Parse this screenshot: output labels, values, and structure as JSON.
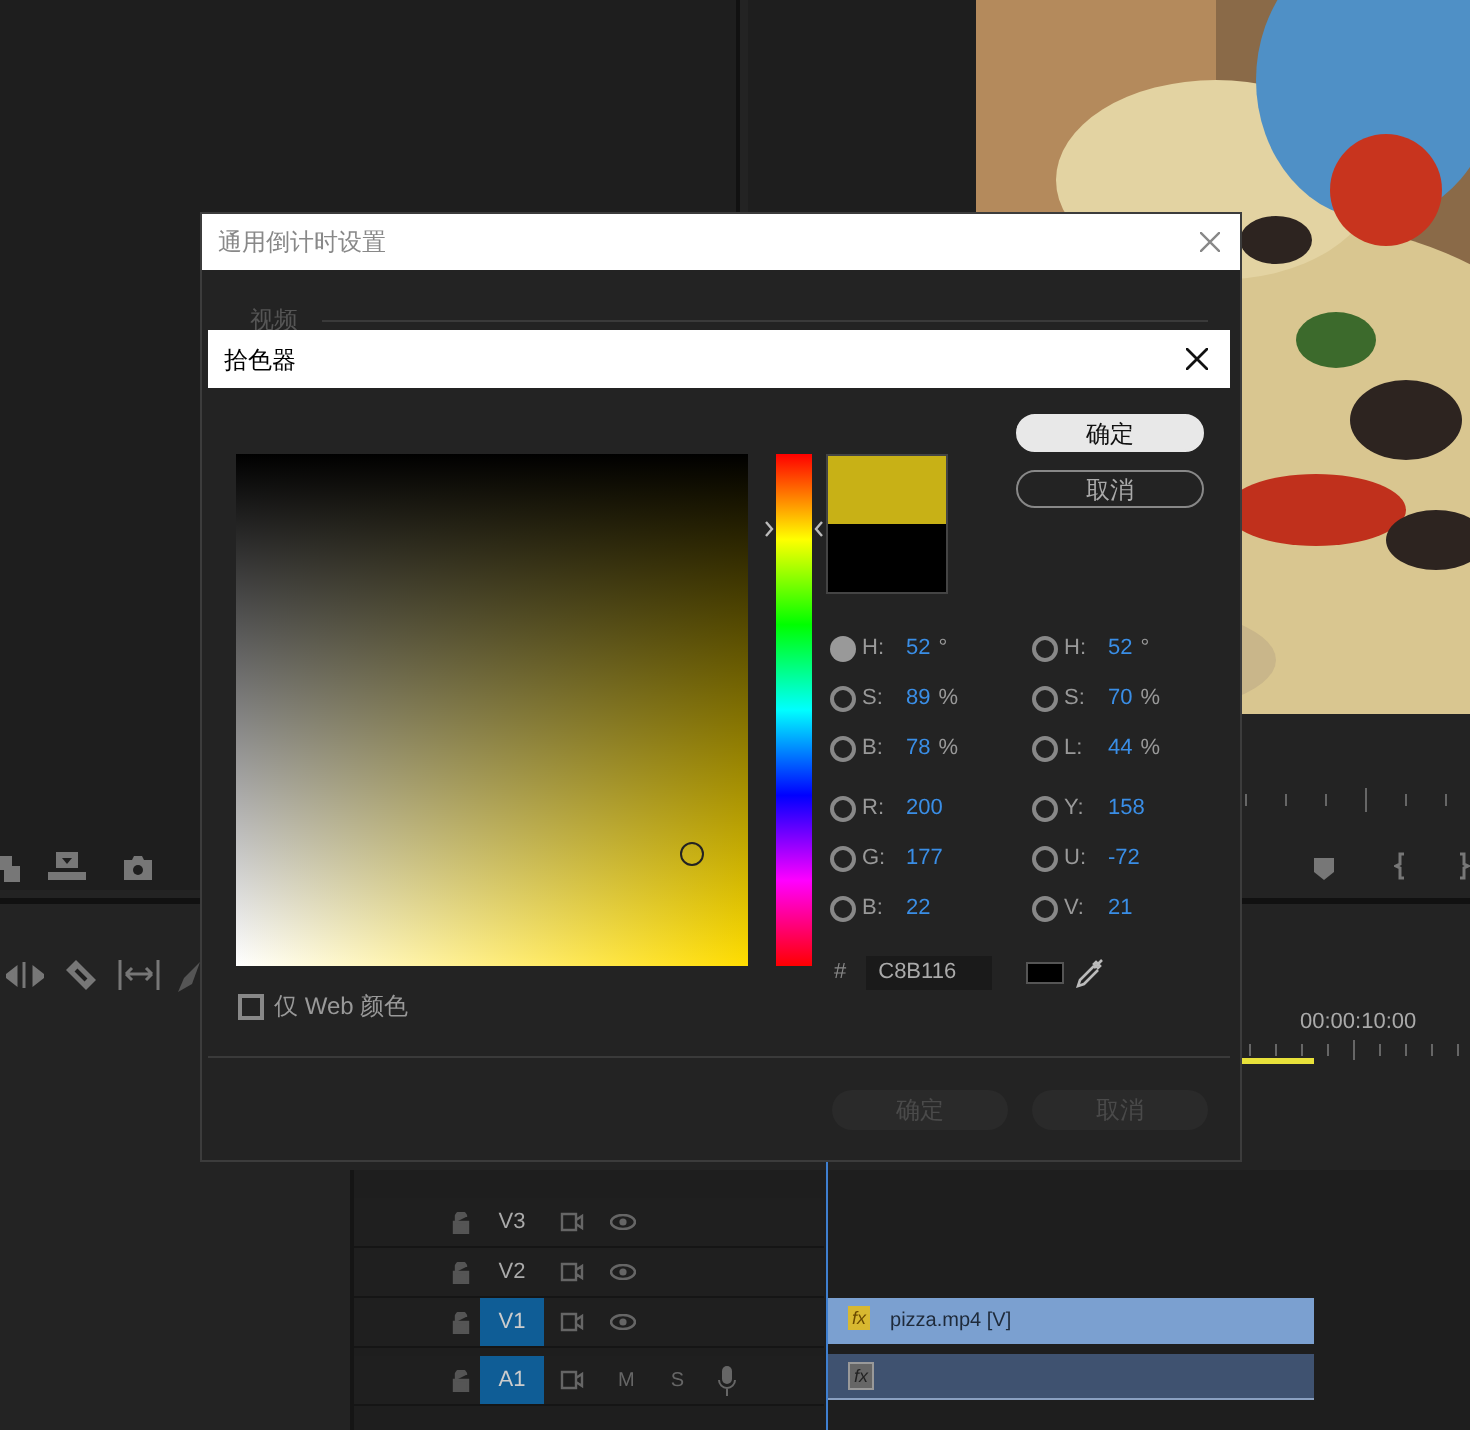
{
  "editor": {
    "timecode": "00:00:10:00",
    "tracks": [
      {
        "name": "V3",
        "kind": "video",
        "selected": false
      },
      {
        "name": "V2",
        "kind": "video",
        "selected": false
      },
      {
        "name": "V1",
        "kind": "video",
        "selected": true
      },
      {
        "name": "A1",
        "kind": "audio",
        "selected": true,
        "mute": "M",
        "solo": "S"
      }
    ],
    "clips": [
      {
        "kind": "video",
        "badge": "fx",
        "label": "pizza.mp4 [V]"
      },
      {
        "kind": "audio",
        "badge": "fx"
      }
    ]
  },
  "outer_dialog": {
    "title": "通用倒计时设置",
    "group_label": "视频",
    "buttons": [
      {
        "label": "确定",
        "disabled": true
      },
      {
        "label": "取消",
        "disabled": true
      }
    ]
  },
  "color_picker": {
    "title": "拾色器",
    "swatches": [
      {
        "color": "#c8b116"
      },
      {
        "color": "#000000"
      }
    ],
    "buttons": [
      {
        "label": "确定",
        "kind": "primary"
      },
      {
        "label": "取消",
        "kind": "secondary"
      }
    ],
    "columns": [
      [
        {
          "label": "H:",
          "value": "52",
          "unit": "°",
          "selected": true
        },
        {
          "label": "S:",
          "value": "89",
          "unit": "%",
          "selected": false
        },
        {
          "label": "B:",
          "value": "78",
          "unit": "%",
          "selected": false
        },
        {
          "label": "R:",
          "value": "200",
          "selected": false
        },
        {
          "label": "G:",
          "value": "177",
          "selected": false
        },
        {
          "label": "B:",
          "value": "22",
          "selected": false
        }
      ],
      [
        {
          "label": "H:",
          "value": "52",
          "unit": "°",
          "selected": false
        },
        {
          "label": "S:",
          "value": "70",
          "unit": "%",
          "selected": false
        },
        {
          "label": "L:",
          "value": "44",
          "unit": "%",
          "selected": false
        },
        {
          "label": "Y:",
          "value": "158",
          "selected": false
        },
        {
          "label": "U:",
          "value": "-72",
          "selected": false
        },
        {
          "label": "V:",
          "value": "21",
          "selected": false
        }
      ]
    ],
    "hex_label": "#",
    "hex": "C8B116",
    "web_only": {
      "label": "仅 Web 颜色",
      "checked": false
    }
  }
}
